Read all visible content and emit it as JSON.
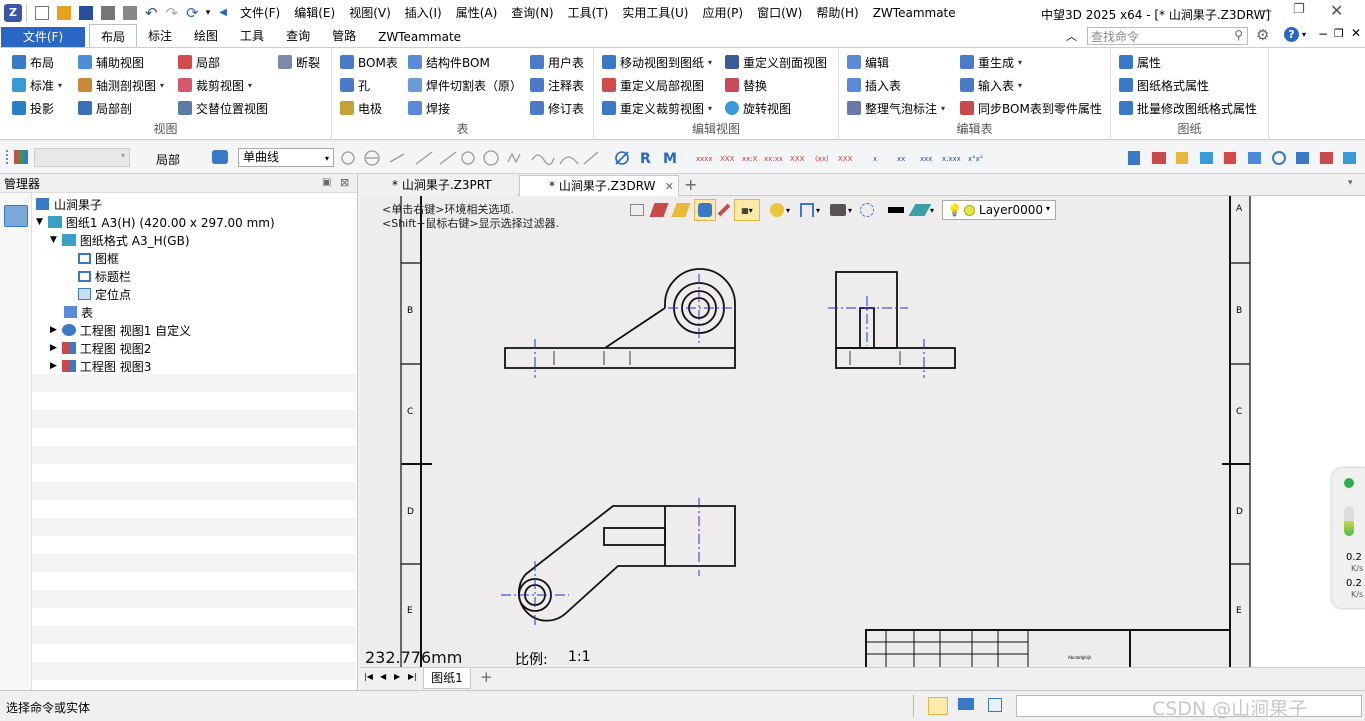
{
  "titlebar": {
    "menus": [
      "文件(F)",
      "编辑(E)",
      "视图(V)",
      "插入(I)",
      "属性(A)",
      "查询(N)",
      "工具(T)",
      "实用工具(U)",
      "应用(P)",
      "窗口(W)",
      "帮助(H)",
      "ZWTeammate"
    ],
    "app_title": "中望3D 2025 x64 - [* 山涧果子.Z3DRW]"
  },
  "ribbon_tabs": {
    "file": "文件(F)",
    "tabs": [
      "布局",
      "标注",
      "绘图",
      "工具",
      "查询",
      "管路",
      "ZWTeammate"
    ],
    "active": "布局",
    "search_placeholder": "查找命令"
  },
  "ribbon": {
    "view_group": {
      "label": "视图",
      "items": [
        "布局",
        "辅助视图",
        "局部",
        "断裂",
        "标准",
        "轴测剖视图",
        "裁剪视图",
        "投影",
        "局部剖",
        "交替位置视图"
      ]
    },
    "table_group": {
      "label": "表",
      "items": [
        "BOM表",
        "结构件BOM",
        "用户表",
        "孔",
        "焊件切割表（原）",
        "注释表",
        "电极",
        "焊接",
        "修订表"
      ]
    },
    "edit_view_group": {
      "label": "编辑视图",
      "items": [
        "移动视图到图纸",
        "重定义剖面视图",
        "重定义局部视图",
        "替换",
        "重定义裁剪视图",
        "旋转视图"
      ]
    },
    "edit_table_group": {
      "label": "编辑表",
      "items": [
        "编辑",
        "重生成",
        "插入表",
        "输入表",
        "整理气泡标注",
        "同步BOM表到零件属性"
      ]
    },
    "sheet_group": {
      "label": "图纸",
      "items": [
        "属性",
        "图纸格式属性",
        "批量修改图纸格式属性"
      ]
    }
  },
  "toolbar2": {
    "local_label": "局部",
    "curve_select": "单曲线"
  },
  "manager": {
    "title": "管理器",
    "tree": [
      {
        "label": "山涧果子",
        "level": 0
      },
      {
        "label": "图纸1 A3(H) (420.00 x 297.00 mm)",
        "level": 1
      },
      {
        "label": "图纸格式 A3_H(GB)",
        "level": 2
      },
      {
        "label": "图框",
        "level": 3
      },
      {
        "label": "标题栏",
        "level": 3
      },
      {
        "label": "定位点",
        "level": 3
      },
      {
        "label": "表",
        "level": 2
      },
      {
        "label": "工程图 视图1 自定义",
        "level": 2
      },
      {
        "label": "工程图 视图2",
        "level": 2
      },
      {
        "label": "工程图 视图3",
        "level": 2
      }
    ]
  },
  "doc_tabs": {
    "tab1": "* 山涧果子.Z3PRT",
    "tab2": "* 山涧果子.Z3DRW"
  },
  "canvas": {
    "hint1": "<单击右键>环境相关选项.",
    "hint2": "<Shift+鼠标右键>显示选择过滤器.",
    "layer": "Layer0000",
    "coordinate": "232.776mm",
    "scale_label": "比例:",
    "scale_value": "1:1",
    "border_letters": [
      "A",
      "B",
      "C",
      "D",
      "E"
    ],
    "title_block_text": "Abcdefghijk"
  },
  "sheet_tab": "图纸1",
  "net_widget": {
    "up": "0.2",
    "up_unit": "K/s",
    "down": "0.2",
    "down_unit": "K/s"
  },
  "statusbar": {
    "message": "选择命令或实体",
    "watermark": "CSDN @山涧果子"
  },
  "colors": {
    "accent": "#2a66c4",
    "drawing_line": "#111111",
    "center_line": "#2233cc"
  }
}
